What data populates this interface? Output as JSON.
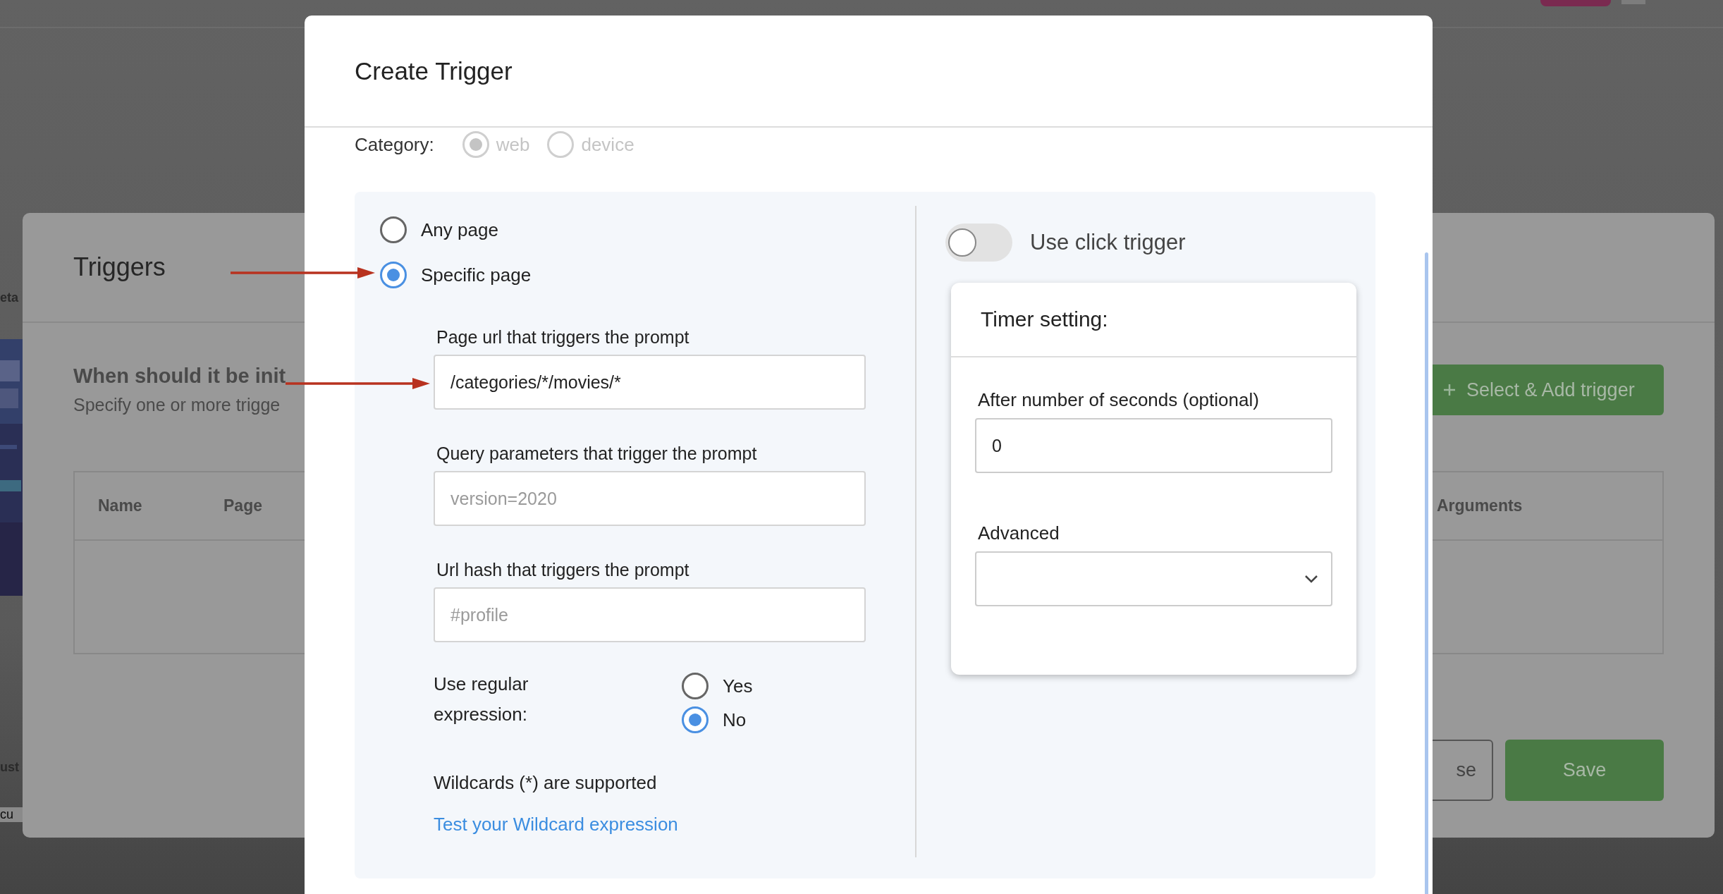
{
  "background_page": {
    "fragment_top": "eta",
    "fragment_middle": "ust",
    "fragment_bottom": "cu"
  },
  "triggers_panel": {
    "title": "Triggers",
    "heading": "When should it be init",
    "subheading": "Specify one or more trigge",
    "add_button": "Select & Add trigger",
    "table": {
      "columns": [
        "Name",
        "Page",
        "Arguments"
      ]
    },
    "buttons": [
      {
        "label": "se",
        "kind": "outline"
      },
      {
        "label": "Save",
        "kind": "primary"
      }
    ]
  },
  "dialog": {
    "title": "Create Trigger",
    "category": {
      "label": "Category:",
      "disabled": true,
      "options": [
        {
          "label": "web",
          "selected": true
        },
        {
          "label": "device",
          "selected": false
        }
      ]
    },
    "page_match": [
      {
        "label": "Any page",
        "selected": false
      },
      {
        "label": "Specific page",
        "selected": true
      }
    ],
    "fields": [
      {
        "label": "Page url that triggers the prompt",
        "value": "/categories/*/movies/*"
      },
      {
        "label": "Query parameters that trigger the prompt",
        "placeholder": "version=2020"
      },
      {
        "label": "Url hash that triggers the prompt",
        "placeholder": "#profile"
      }
    ],
    "regex": {
      "label": "Use regular expression:",
      "options": [
        {
          "label": "Yes",
          "selected": false
        },
        {
          "label": "No",
          "selected": true
        }
      ]
    },
    "note": "Wildcards (*) are supported",
    "link": "Test your Wildcard expression",
    "click_trigger": {
      "label": "Use click trigger",
      "on": false
    },
    "timer": {
      "title": "Timer setting:",
      "seconds": {
        "label": "After number of seconds (optional)",
        "value": "0"
      },
      "advanced": {
        "label": "Advanced"
      }
    }
  }
}
